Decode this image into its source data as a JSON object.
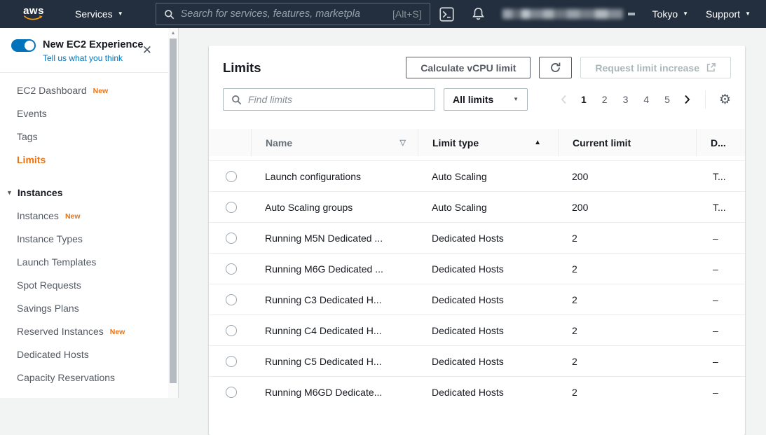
{
  "colors": {
    "topbar_bg": "#232f3e",
    "accent_orange": "#ec7211",
    "smile_orange": "#ff9900",
    "link_blue": "#0073bb",
    "text_dark": "#16191f",
    "text_gray": "#545b64"
  },
  "icons": {
    "caret_down": "▼",
    "close": "✕",
    "gear": "⚙",
    "sort_asc": "▲",
    "sort_unsorted": "▽",
    "scroll_up": "▲"
  },
  "topbar": {
    "logo_text": "aws",
    "services": "Services",
    "search_placeholder": "Search for services, features, marketpla",
    "search_shortcut": "[Alt+S]",
    "region": "Tokyo",
    "support": "Support"
  },
  "sidebar": {
    "experience": {
      "title": "New EC2 Experience",
      "subtitle": "Tell us what you think"
    },
    "items": [
      {
        "label": "EC2 Dashboard",
        "badge": "New"
      },
      {
        "label": "Events"
      },
      {
        "label": "Tags"
      },
      {
        "label": "Limits",
        "selected": true
      },
      {
        "label": "Instances",
        "section": true
      },
      {
        "label": "Instances",
        "badge": "New"
      },
      {
        "label": "Instance Types"
      },
      {
        "label": "Launch Templates"
      },
      {
        "label": "Spot Requests"
      },
      {
        "label": "Savings Plans"
      },
      {
        "label": "Reserved Instances",
        "badge": "New"
      },
      {
        "label": "Dedicated Hosts"
      },
      {
        "label": "Capacity Reservations"
      }
    ]
  },
  "main": {
    "title": "Limits",
    "calculate_button": "Calculate vCPU limit",
    "request_button": "Request limit increase",
    "find_placeholder": "Find limits",
    "filter_selected": "All limits",
    "pagination": {
      "pages": [
        "1",
        "2",
        "3",
        "4",
        "5"
      ],
      "current": "1"
    },
    "table": {
      "columns": {
        "name": "Name",
        "type": "Limit type",
        "current": "Current limit",
        "desc": "D..."
      },
      "rows": [
        {
          "name": "Launch configurations",
          "type": "Auto Scaling",
          "limit": "200",
          "desc": "T..."
        },
        {
          "name": "Auto Scaling groups",
          "type": "Auto Scaling",
          "limit": "200",
          "desc": "T..."
        },
        {
          "name": "Running M5N Dedicated ...",
          "type": "Dedicated Hosts",
          "limit": "2",
          "desc": "–"
        },
        {
          "name": "Running M6G Dedicated ...",
          "type": "Dedicated Hosts",
          "limit": "2",
          "desc": "–"
        },
        {
          "name": "Running C3 Dedicated H...",
          "type": "Dedicated Hosts",
          "limit": "2",
          "desc": "–"
        },
        {
          "name": "Running C4 Dedicated H...",
          "type": "Dedicated Hosts",
          "limit": "2",
          "desc": "–"
        },
        {
          "name": "Running C5 Dedicated H...",
          "type": "Dedicated Hosts",
          "limit": "2",
          "desc": "–"
        },
        {
          "name": "Running M6GD Dedicate...",
          "type": "Dedicated Hosts",
          "limit": "2",
          "desc": "–"
        }
      ]
    }
  }
}
